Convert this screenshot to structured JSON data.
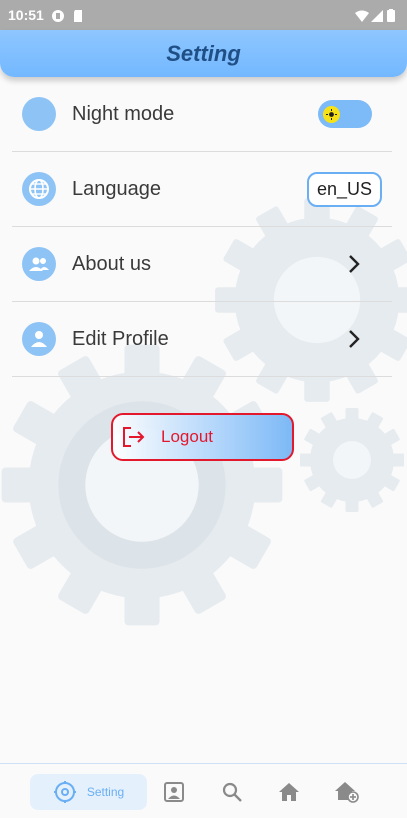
{
  "status_bar": {
    "time": "10:51"
  },
  "app_bar": {
    "title": "Setting"
  },
  "settings": {
    "night_mode": {
      "label": "Night mode",
      "icon": "moon-icon",
      "toggle_icon": "sun-icon"
    },
    "language": {
      "label": "Language",
      "icon": "globe-icon",
      "value": "en_US"
    },
    "about_us": {
      "label": "About us",
      "icon": "people-icon"
    },
    "edit_profile": {
      "label": "Edit Profile",
      "icon": "person-icon"
    }
  },
  "logout": {
    "label": "Logout",
    "icon": "logout-icon"
  },
  "bottom_nav": {
    "items": [
      {
        "label": "Setting",
        "icon": "gear-icon",
        "active": true
      },
      {
        "label": "",
        "icon": "profile-icon"
      },
      {
        "label": "",
        "icon": "search-icon"
      },
      {
        "label": "",
        "icon": "home-icon"
      },
      {
        "label": "",
        "icon": "add-home-icon"
      }
    ]
  },
  "colors": {
    "accent": "#8ec3f6",
    "app_bar": "#7ab9ff",
    "title": "#1f4f85",
    "logout": "#e3182d"
  }
}
